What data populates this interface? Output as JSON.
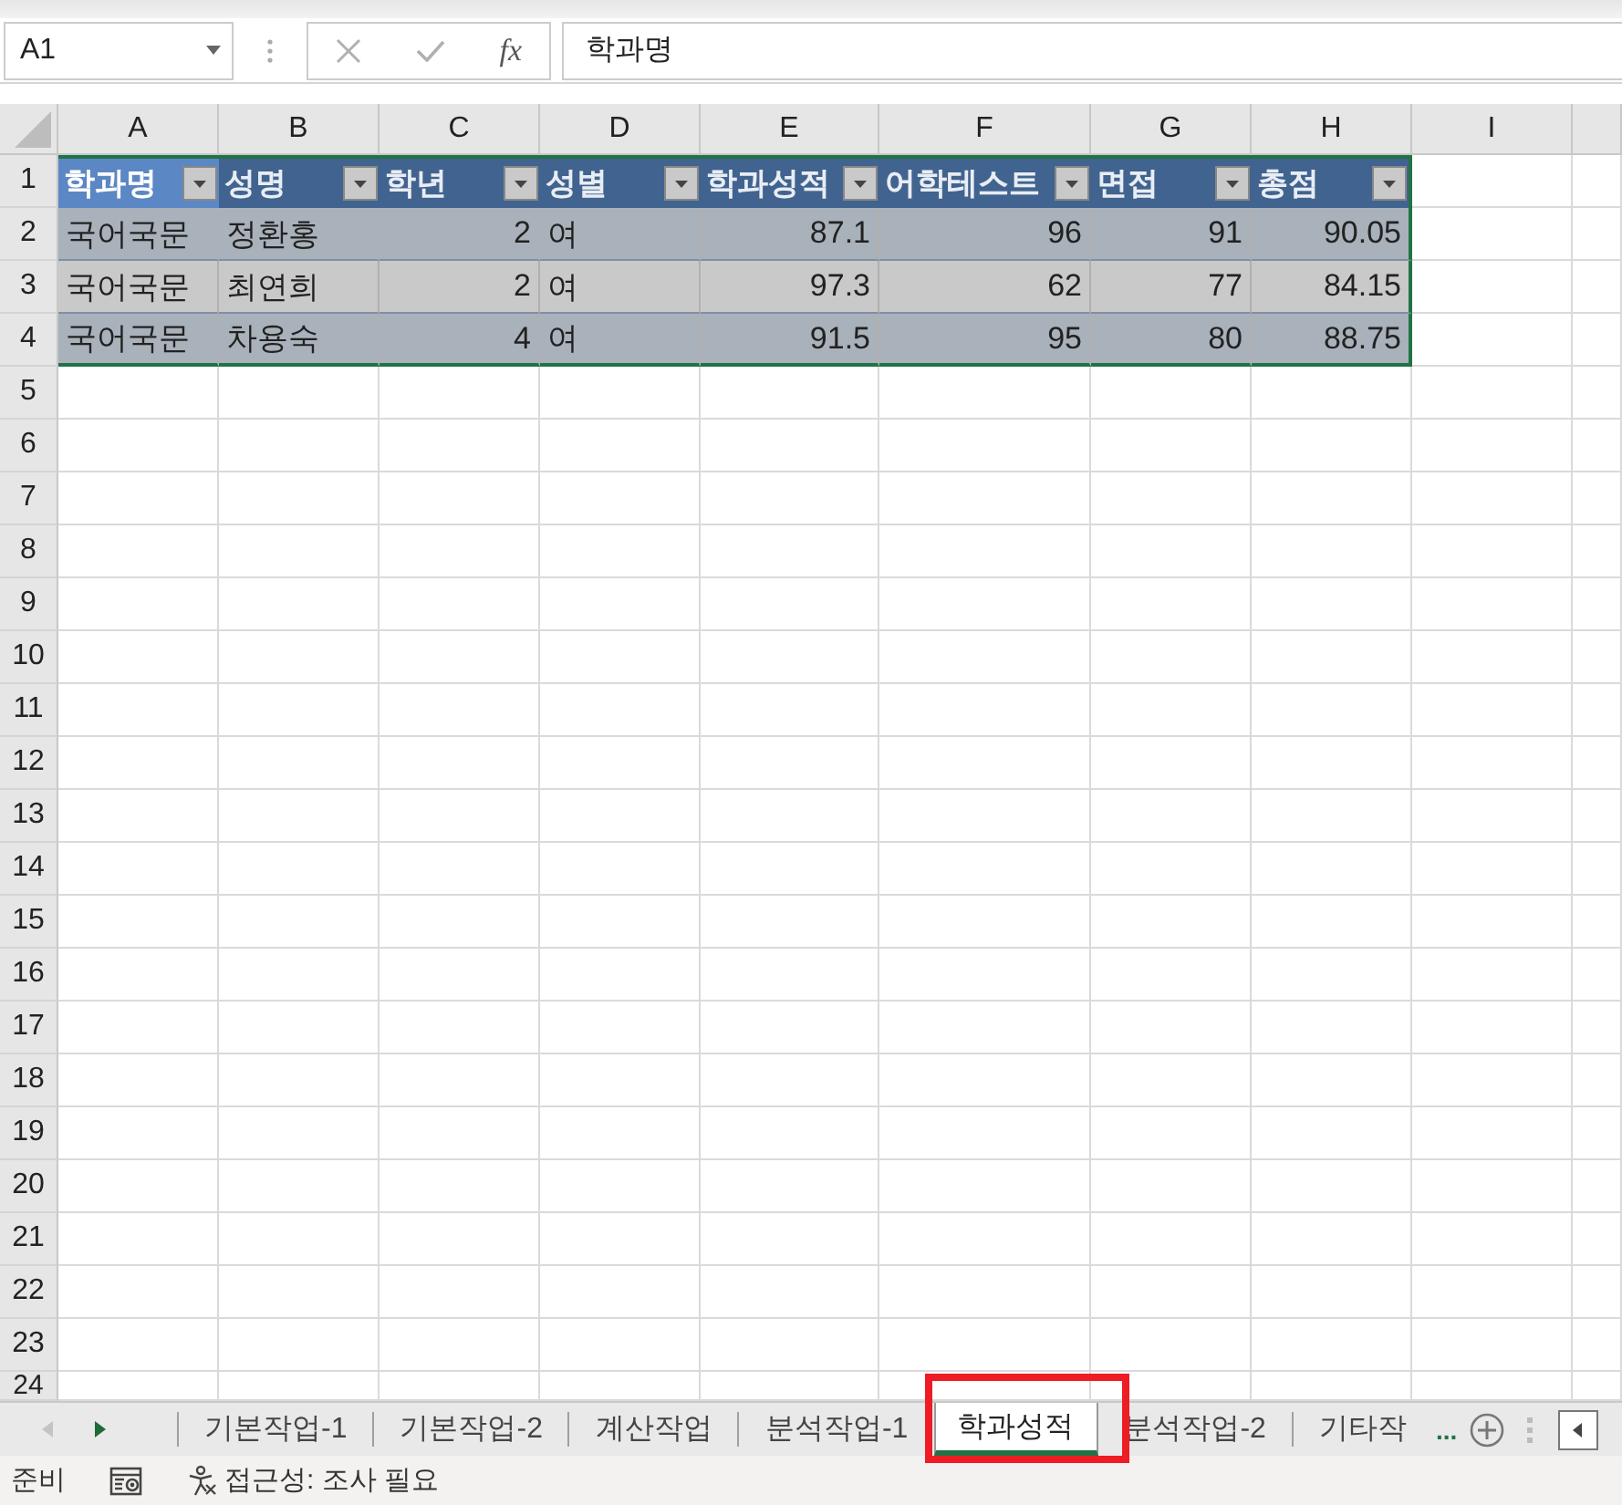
{
  "formula_bar": {
    "name_box": "A1",
    "function_symbol": "fx",
    "value": "학과명"
  },
  "sheet": {
    "columns": [
      "A",
      "B",
      "C",
      "D",
      "E",
      "F",
      "G",
      "H",
      "I"
    ],
    "row_headers": [
      "1",
      "2",
      "3",
      "4",
      "5",
      "6",
      "7",
      "8",
      "9",
      "10",
      "11",
      "12",
      "13",
      "14",
      "15",
      "16",
      "17",
      "18",
      "19",
      "20",
      "21",
      "22",
      "23",
      "24"
    ],
    "table_header": [
      {
        "label": "학과명",
        "kind": "text",
        "selected": true
      },
      {
        "label": "성명",
        "kind": "text",
        "selected": false
      },
      {
        "label": "학년",
        "kind": "number",
        "selected": false
      },
      {
        "label": "성별",
        "kind": "text",
        "selected": false
      },
      {
        "label": "학과성적",
        "kind": "number",
        "selected": false
      },
      {
        "label": "어학테스트",
        "kind": "number",
        "selected": false
      },
      {
        "label": "면접",
        "kind": "number",
        "selected": false
      },
      {
        "label": "총점",
        "kind": "number",
        "selected": false
      }
    ],
    "table_rows": [
      [
        "국어국문",
        "정환홍",
        "2",
        "여",
        "87.1",
        "96",
        "91",
        "90.05"
      ],
      [
        "국어국문",
        "최연희",
        "2",
        "여",
        "97.3",
        "62",
        "77",
        "84.15"
      ],
      [
        "국어국문",
        "차용숙",
        "4",
        "여",
        "91.5",
        "95",
        "80",
        "88.75"
      ]
    ]
  },
  "sheet_tabs": [
    {
      "label": "기본작업-1",
      "selected": false
    },
    {
      "label": "기본작업-2",
      "selected": false
    },
    {
      "label": "계산작업",
      "selected": false
    },
    {
      "label": "분석작업-1",
      "selected": false
    },
    {
      "label": "학과성적",
      "selected": true
    },
    {
      "label": "분석작업-2",
      "selected": false
    },
    {
      "label": "기타작",
      "selected": false
    }
  ],
  "more_tabs": "...",
  "status_bar": {
    "mode": "준비",
    "accessibility": "접근성: 조사 필요"
  }
}
